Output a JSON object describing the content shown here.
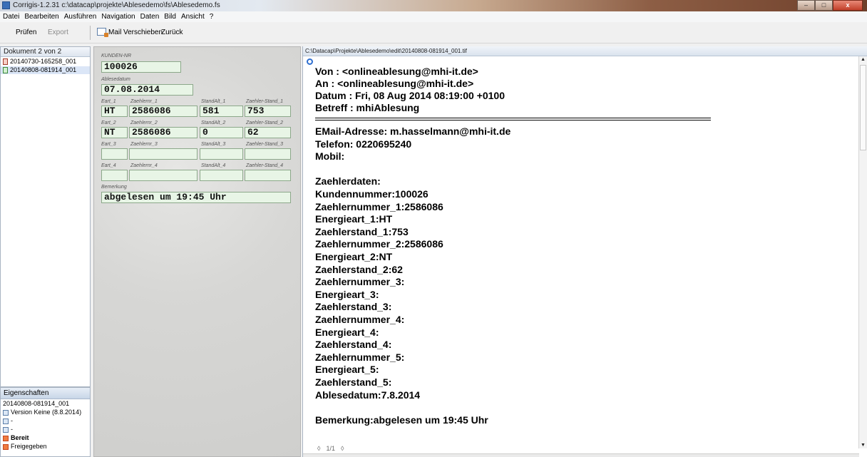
{
  "window": {
    "title": "Corrigis-1.2.31  c:\\datacap\\projekte\\Ablesedemo\\fs\\Ablesedemo.fs",
    "minimize": "–",
    "maximize": "□",
    "close": "x"
  },
  "menu": [
    "Datei",
    "Bearbeiten",
    "Ausführen",
    "Navigation",
    "Daten",
    "Bild",
    "Ansicht",
    "?"
  ],
  "toolbar": {
    "pruefen": "Prüfen",
    "export": "Export",
    "mail": "Mail",
    "verschieben": "Verschieben",
    "zurueck": "Zurück"
  },
  "documents": {
    "header": "Dokument 2 von 2",
    "items": [
      "20140730-165258_001",
      "20140808-081914_001"
    ]
  },
  "properties": {
    "header": "Eigenschaften",
    "id": "20140808-081914_001",
    "version": "Version Keine (8.8.2014)",
    "line3": "-",
    "line4": "-",
    "status1": "Bereit",
    "status2": "Freigegeben"
  },
  "form": {
    "kunden_label": "KUNDEN-NR",
    "kunden_value": "100026",
    "datum_label": "Ablesedatum",
    "datum_value": "07.08.2014",
    "rows": [
      {
        "l_art": "Eart_1",
        "l_nr": "Zaehlernr_1",
        "l_alt": "StandAlt_1",
        "l_stand": "Zaehler-Stand_1",
        "art": "HT",
        "nr": "2586086",
        "alt": "581",
        "stand": "753"
      },
      {
        "l_art": "Eart_2",
        "l_nr": "Zaehlernr_2",
        "l_alt": "StandAlt_2",
        "l_stand": "Zaehler-Stand_2",
        "art": "NT",
        "nr": "2586086",
        "alt": "0",
        "stand": "62"
      },
      {
        "l_art": "Eart_3",
        "l_nr": "Zaehlernr_3",
        "l_alt": "StandAlt_3",
        "l_stand": "Zaehler-Stand_3",
        "art": "",
        "nr": "",
        "alt": "",
        "stand": ""
      },
      {
        "l_art": "Eart_4",
        "l_nr": "Zaehlernr_4",
        "l_alt": "StandAlt_4",
        "l_stand": "Zaehler-Stand_4",
        "art": "",
        "nr": "",
        "alt": "",
        "stand": ""
      }
    ],
    "bemerkung_label": "Bemerkung",
    "bemerkung_value": "abgelesen um 19:45 Uhr"
  },
  "image": {
    "path": "C:\\Datacap\\Projekte\\Ablesedemo\\edit\\20140808-081914_001.tif",
    "header_lines": [
      "Von : <onlineablesung@mhi-it.de>",
      "An  : <onlineablesung@mhi-it.de>",
      "Datum : Fri, 08 Aug 2014 08:19:00 +0100",
      "Betreff : mhiAblesung"
    ],
    "body_lines": [
      "EMail-Adresse: m.hasselmann@mhi-it.de",
      "Telefon: 0220695240",
      "Mobil:",
      "",
      "Zaehlerdaten:",
      "Kundennummer:100026",
      "Zaehlernummer_1:2586086",
      "Energieart_1:HT",
      "Zaehlerstand_1:753",
      "Zaehlernummer_2:2586086",
      "Energieart_2:NT",
      "Zaehlerstand_2:62",
      "Zaehlernummer_3:",
      "Energieart_3:",
      "Zaehlerstand_3:",
      "Zaehlernummer_4:",
      "Energieart_4:",
      "Zaehlerstand_4:",
      "Zaehlernummer_5:",
      "Energieart_5:",
      "Zaehlerstand_5:",
      "Ablesedatum:7.8.2014",
      "",
      "Bemerkung:abgelesen um 19:45 Uhr"
    ],
    "pager": "1/1"
  }
}
